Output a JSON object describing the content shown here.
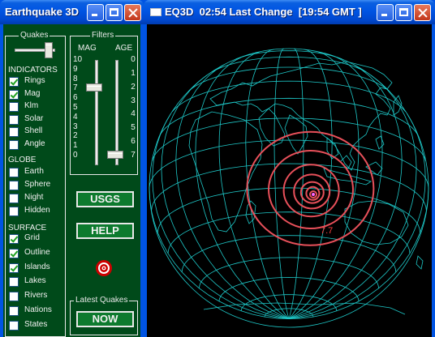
{
  "left_window": {
    "title": "Earthquake 3D",
    "groups": {
      "quakes": "Quakes",
      "filters": "Filters",
      "latest": "Latest Quakes"
    },
    "filters": {
      "mag_label": "MAG",
      "age_label": "AGE",
      "mag_scale": [
        "10",
        "9",
        "8",
        "7",
        "6",
        "5",
        "4",
        "3",
        "2",
        "1",
        "0"
      ],
      "age_scale": [
        "0",
        "1",
        "2",
        "3",
        "4",
        "5",
        "6",
        "7"
      ],
      "mag_value": 7,
      "age_value": 7
    },
    "sections": {
      "indicators": "INDICATORS",
      "globe": "GLOBE",
      "surface": "SURFACE"
    },
    "indicators": [
      {
        "label": "Rings",
        "checked": true
      },
      {
        "label": "Mag",
        "checked": true
      },
      {
        "label": "Klm",
        "checked": false
      },
      {
        "label": "Solar",
        "checked": false
      },
      {
        "label": "Shell",
        "checked": false
      },
      {
        "label": "Angle",
        "checked": false
      }
    ],
    "globe": [
      {
        "label": "Earth",
        "checked": false
      },
      {
        "label": "Sphere",
        "checked": false
      },
      {
        "label": "Night",
        "checked": false
      },
      {
        "label": "Hidden",
        "checked": false
      }
    ],
    "surface": [
      {
        "label": "Grid",
        "checked": true
      },
      {
        "label": "Outline",
        "checked": true
      },
      {
        "label": "Islands",
        "checked": true
      },
      {
        "label": "Lakes",
        "checked": false
      },
      {
        "label": "Rivers",
        "checked": false
      },
      {
        "label": "Nations",
        "checked": false
      },
      {
        "label": "States",
        "checked": false
      }
    ],
    "buttons": {
      "usgs": "USGS",
      "help": "HELP",
      "now": "NOW"
    }
  },
  "right_window": {
    "title": "EQ3D  02:54 Last Change  [19:54 GMT ]",
    "quake_label": "7.7",
    "colors": {
      "grid": "#1ec8c8",
      "rings": "#e8505a",
      "quake_label": "#ff4040",
      "background": "#000000"
    }
  },
  "window_buttons": [
    "minimize-icon",
    "maximize-icon",
    "close-icon"
  ]
}
